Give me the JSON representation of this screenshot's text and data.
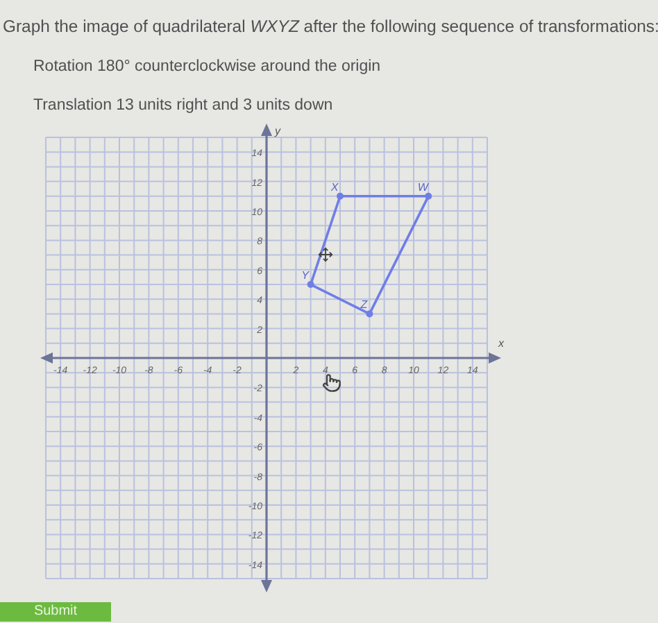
{
  "question": {
    "prompt": "Graph the image of quadrilateral *WXYZ* after the following sequence of transformations:",
    "steps": [
      "Rotation 180° counterclockwise around the origin",
      "Translation 13 units right and 3 units down"
    ]
  },
  "graph": {
    "chart_data": {
      "type": "scatter",
      "xlabel": "x",
      "ylabel": "y",
      "xlim": [
        -15,
        15
      ],
      "ylim": [
        -15,
        15
      ],
      "xticks": [
        -14,
        -12,
        -10,
        -8,
        -6,
        -4,
        -2,
        2,
        4,
        6,
        8,
        10,
        12,
        14
      ],
      "yticks": [
        -14,
        -12,
        -10,
        -8,
        -6,
        -4,
        -2,
        2,
        4,
        6,
        8,
        10,
        12,
        14
      ],
      "x": [
        11,
        5,
        3,
        7
      ],
      "grid": true,
      "series": [
        {
          "color": "#6f7ee6",
          "values": [
            11,
            11,
            5,
            3
          ]
        }
      ],
      "annotations": [
        {
          "text": "W",
          "x": 11,
          "y": 11
        },
        {
          "text": "X",
          "x": 5,
          "y": 11
        },
        {
          "text": "Y",
          "x": 3,
          "y": 5
        },
        {
          "text": "Z",
          "x": 7,
          "y": 3
        }
      ]
    }
  },
  "submit": {
    "label": "Submit"
  }
}
